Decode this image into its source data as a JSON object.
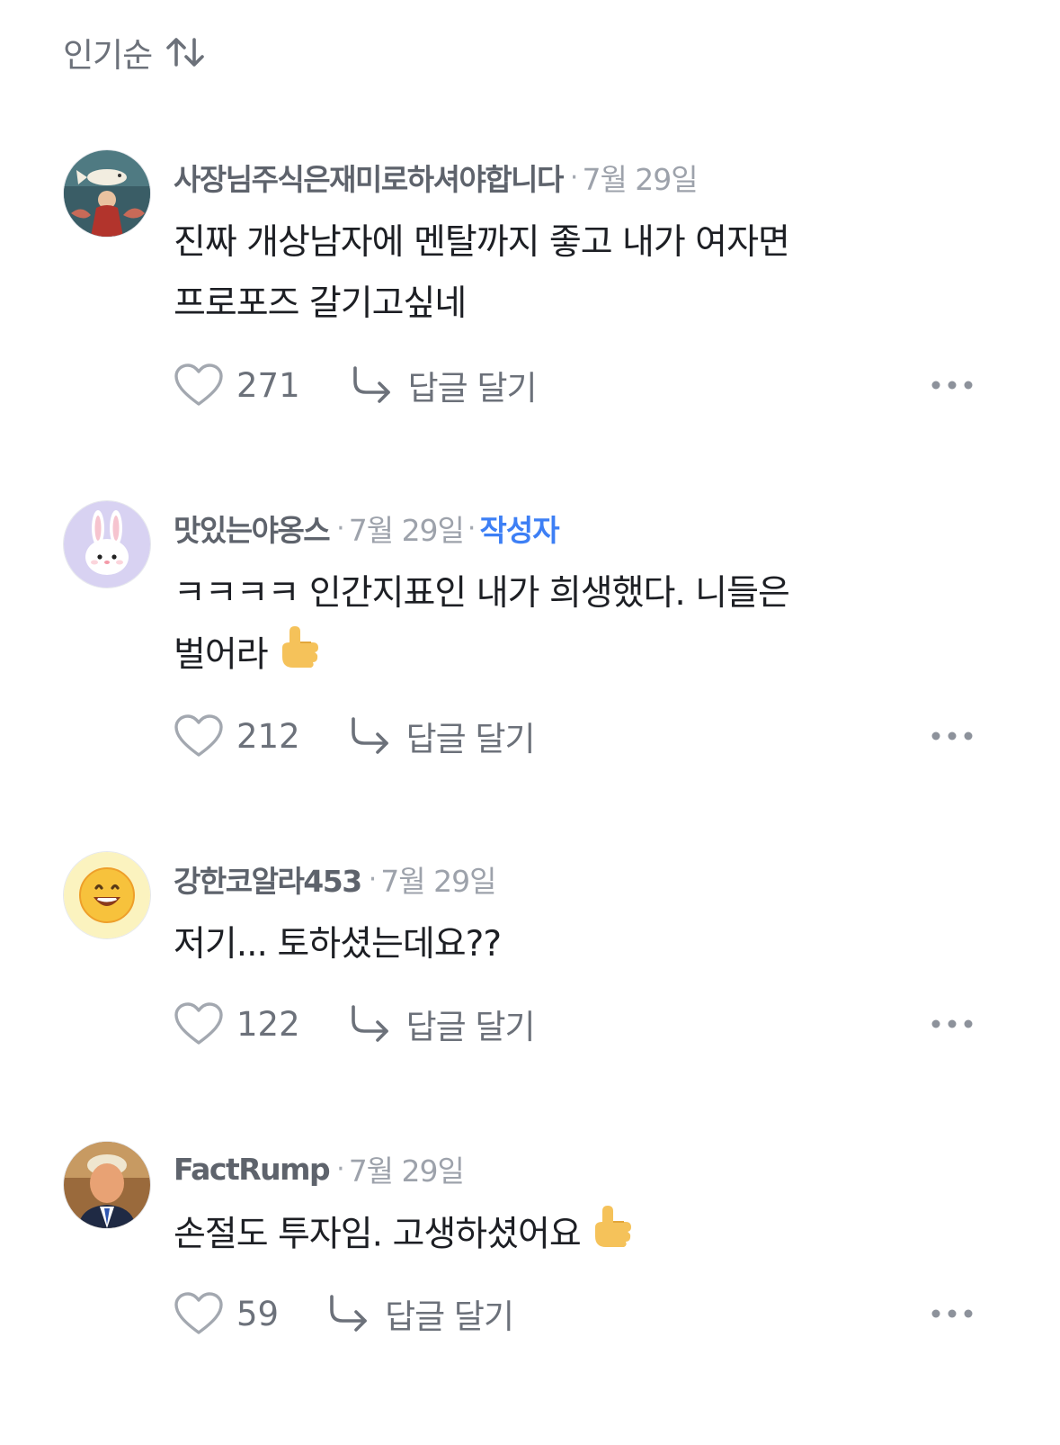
{
  "sort": {
    "label": "인기순",
    "icon": "sort-arrows-icon"
  },
  "reply_label": "답글 달기",
  "comments": [
    {
      "author": "사장님주식은재미로하셔야합니다",
      "date": "7월 29일",
      "badge": "",
      "lines": [
        "진짜 개상남자에 멘탈까지 좋고 내가 여자면",
        "프로포즈 갈기고싶네"
      ],
      "likes": "271",
      "avatar": "painting-avatar"
    },
    {
      "author": "맛있는야옹스",
      "date": "7월 29일",
      "badge": "작성자",
      "lines": [
        "ㅋㅋㅋㅋ 인간지표인 내가 희생했다. 니들은",
        "벌어라"
      ],
      "likes": "212",
      "avatar": "bunny-avatar"
    },
    {
      "author": "강한코알라453",
      "date": "7월 29일",
      "badge": "",
      "lines": [
        "저기... 토하셨는데요??"
      ],
      "likes": "122",
      "avatar": "smiley-avatar"
    },
    {
      "author": "FactRump",
      "date": "7월 29일",
      "badge": "",
      "lines": [
        "손절도 투자임. 고생하셨어요"
      ],
      "likes": "59",
      "avatar": "portrait-avatar"
    }
  ],
  "colors": {
    "accent": "#3d7ff5",
    "muted": "#6c717a",
    "text": "#1d1f24"
  }
}
